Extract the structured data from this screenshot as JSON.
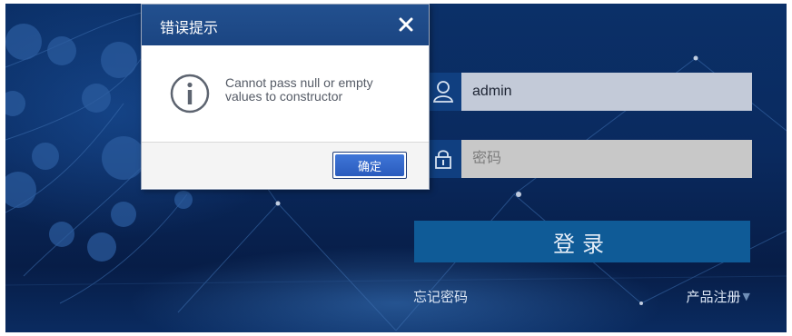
{
  "dialog": {
    "title": "错误提示",
    "message": "Cannot pass null or empty values to constructor",
    "ok_label": "确定",
    "icons": {
      "close": "close-icon",
      "info": "info-icon"
    }
  },
  "login": {
    "username_value": "admin",
    "password_placeholder": "密码",
    "submit_label": "登录",
    "forgot_password": "忘记密码",
    "product_register": "产品注册",
    "icons": {
      "user": "user-icon",
      "lock": "lock-icon",
      "dropdown": "caret-down-icon"
    }
  },
  "colors": {
    "background": "#0a2a5f",
    "dialog_header": "#1f4a88",
    "login_button": "#0f5b97",
    "ok_button": "#2f62c8"
  }
}
